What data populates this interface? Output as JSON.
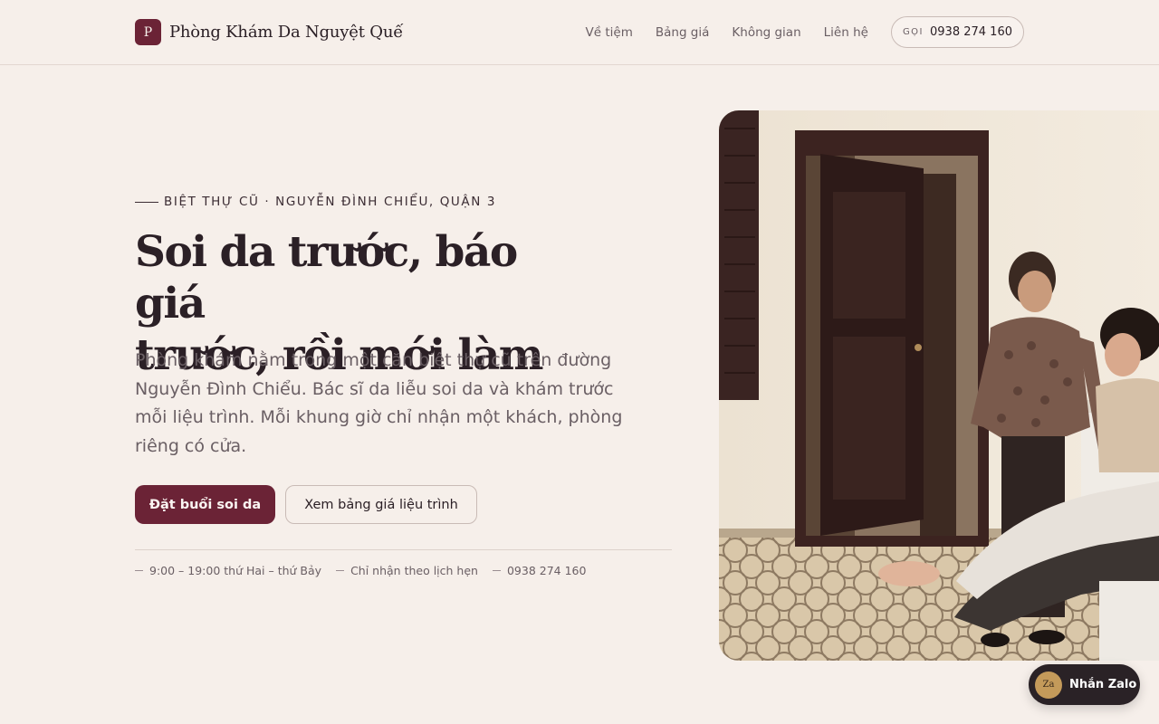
{
  "brand": {
    "mark": "P",
    "name": "Phòng Khám Da Nguyệt Quế"
  },
  "nav": {
    "links": [
      "Về tiệm",
      "Bảng giá",
      "Không gian",
      "Liên hệ"
    ],
    "call_label": "GỌI",
    "call_number": "0938 274 160"
  },
  "hero": {
    "eyebrow": "BIỆT THỰ CŨ · NGUYỄN ĐÌNH CHIỂU, QUẬN 3",
    "headline_line1": "Soi da trước, báo giá",
    "headline_line2": "trước, rồi mới làm",
    "lead": "Phòng khám nằm trong một căn biệt thự cũ trên đường Nguyễn Đình Chiểu. Bác sĩ da liễu soi da và khám trước mỗi liệu trình. Mỗi khung giờ chỉ nhận một khách, phòng riêng có cửa.",
    "primary_cta": "Đặt buổi soi da",
    "secondary_cta": "Xem bảng giá liệu trình",
    "facts": [
      "9:00 – 19:00 thứ Hai – thứ Bảy",
      "Chỉ nhận theo lịch hẹn",
      "0938 274 160"
    ]
  },
  "chat": {
    "icon_text": "Za",
    "label": "Nhắn Zalo"
  },
  "colors": {
    "background": "#f6efea",
    "accent": "#6b2336",
    "text": "#2b2026",
    "muted": "#6a5f64",
    "chat_bg": "#2a2226"
  }
}
